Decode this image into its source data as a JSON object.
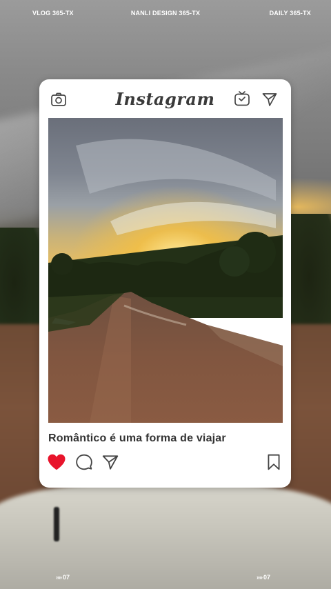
{
  "top_labels": {
    "left": "VLOG 365-TX",
    "center": "NANLI DESIGN 365-TX",
    "right": "DAILY 365-TX"
  },
  "card": {
    "brand": "Instagram",
    "caption": "Romântico é uma forma de viajar",
    "icons": {
      "camera": "camera-icon",
      "igtv": "igtv-icon",
      "direct": "send-icon",
      "like": "heart-icon",
      "comment": "comment-icon",
      "share": "send-icon",
      "save": "bookmark-icon"
    },
    "like_color": "#e8142b"
  },
  "bottom_marks": {
    "left": "07",
    "right": "07",
    "symbol": "»»"
  }
}
